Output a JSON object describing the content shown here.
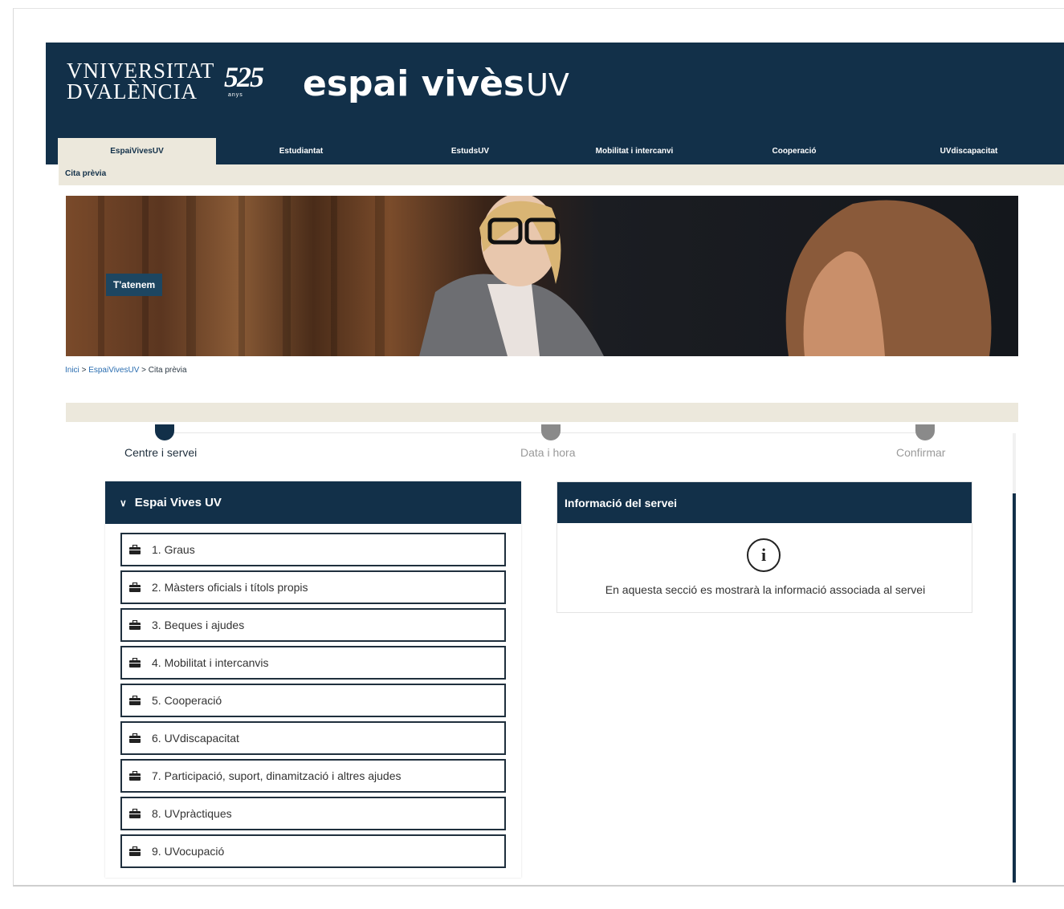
{
  "header": {
    "uv_logo_line1": "VNIVERSITAT",
    "uv_logo_line2": "DVALÈNCIA",
    "anniversary": "525",
    "anniversary_sub": "anys",
    "site_name": "espai vivès",
    "site_suffix": "UV"
  },
  "nav": {
    "tabs": [
      {
        "label": "EspaiVivesUV"
      },
      {
        "label": "Estudiantat"
      },
      {
        "label": "EstudsUV"
      },
      {
        "label": "Mobilitat i intercanvi"
      },
      {
        "label": "Cooperació"
      },
      {
        "label": "UVdiscapacitat"
      }
    ],
    "subnav_label": "Cita prèvia"
  },
  "banner": {
    "label": "T'atenem"
  },
  "breadcrumb": {
    "home": "Inici",
    "section": "EspaiVivesUV",
    "current": "Cita prèvia",
    "separator": ">"
  },
  "stepper": {
    "steps": [
      {
        "label": "Centre i servei",
        "active": true
      },
      {
        "label": "Data i hora",
        "active": false
      },
      {
        "label": "Confirmar",
        "active": false
      }
    ]
  },
  "services_panel": {
    "title": "Espai Vives UV",
    "items": [
      {
        "label": "1. Graus"
      },
      {
        "label": "2. Màsters oficials i títols propis"
      },
      {
        "label": "3. Beques i ajudes"
      },
      {
        "label": "4. Mobilitat i intercanvis"
      },
      {
        "label": "5. Cooperació"
      },
      {
        "label": "6. UVdiscapacitat"
      },
      {
        "label": "7. Participació, suport, dinamització i altres ajudes"
      },
      {
        "label": "8. UVpràctiques"
      },
      {
        "label": "9. UVocupació"
      }
    ]
  },
  "info_panel": {
    "title": "Informació del servei",
    "icon": "info-icon",
    "icon_glyph": "i",
    "message": "En aquesta secció es mostrarà la informació associada al servei"
  },
  "colors": {
    "primary": "#123049",
    "beige": "#ece8dc",
    "step_inactive": "#8a8a8a",
    "link": "#2a6db0"
  }
}
